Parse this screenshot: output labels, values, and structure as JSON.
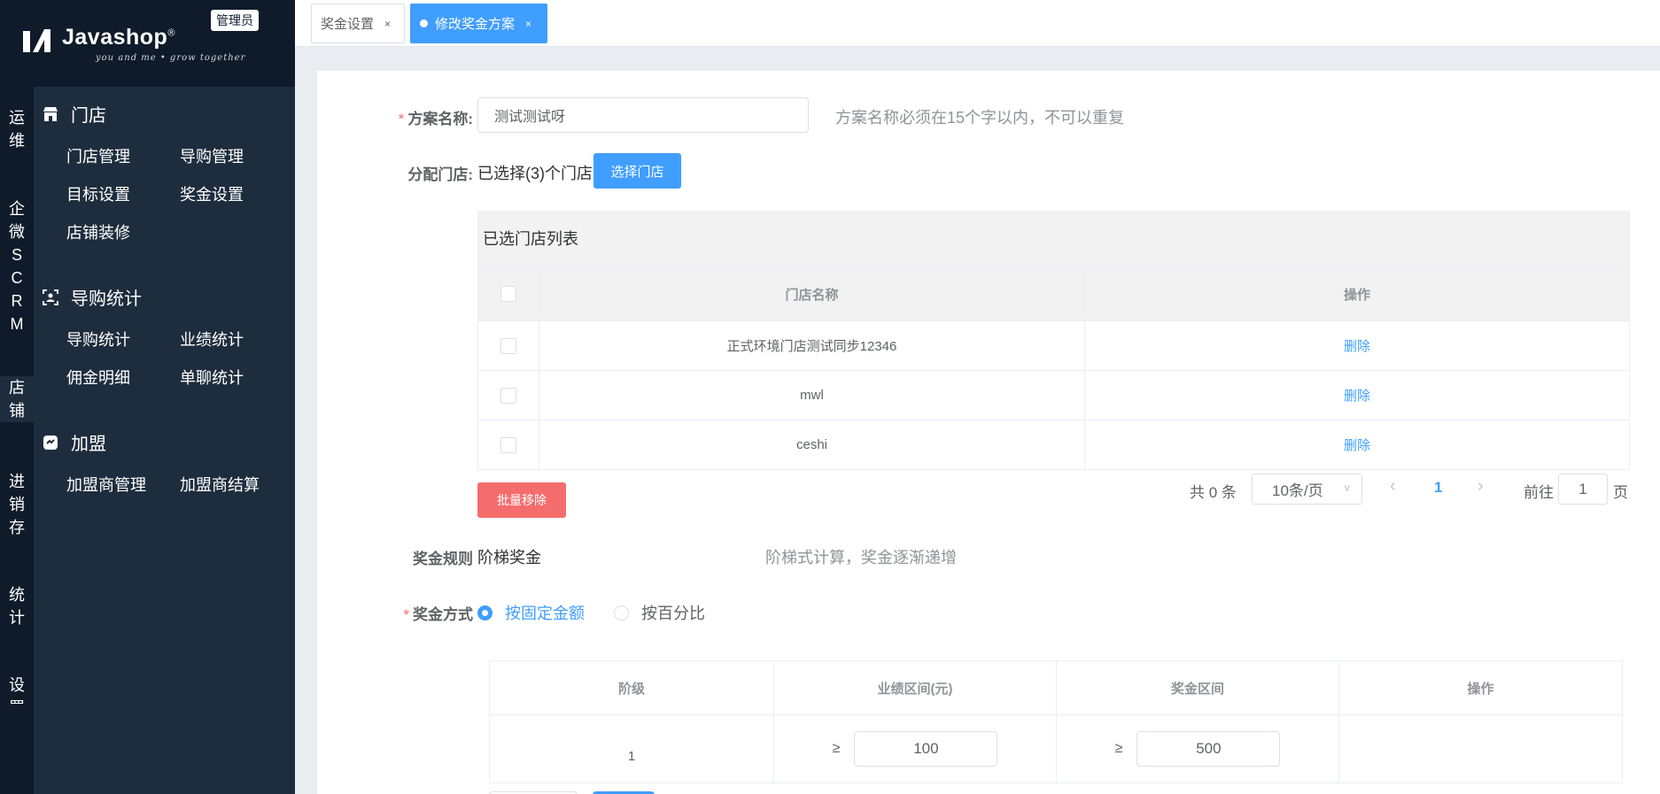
{
  "brand": {
    "logo_text": "Javashop",
    "logo_reg": "®",
    "logo_sub": "you and me • grow together",
    "admin_badge": "管理员"
  },
  "vnav": [
    "运维",
    "企微SCRM",
    "店铺",
    "进销存",
    "统计",
    "设置"
  ],
  "subnav": {
    "groups": [
      {
        "title": "门店",
        "icon": "store-icon",
        "links": [
          "门店管理",
          "导购管理",
          "目标设置",
          "奖金设置",
          "店铺装修"
        ]
      },
      {
        "title": "导购统计",
        "icon": "user-frame-icon",
        "links": [
          "导购统计",
          "业绩统计",
          "佣金明细",
          "单聊统计"
        ]
      },
      {
        "title": "加盟",
        "icon": "franchise-icon",
        "links": [
          "加盟商管理",
          "加盟商结算"
        ]
      }
    ]
  },
  "tabs": [
    {
      "label": "奖金设置",
      "close": "×"
    },
    {
      "label": "修改奖金方案",
      "close": "×"
    }
  ],
  "form": {
    "plan_name_label": "方案名称:",
    "plan_name_value": "测试测试呀",
    "plan_name_hint": "方案名称必须在15个字以内，不可以重复",
    "assign_label": "分配门店:",
    "assign_text": "已选择(3)个门店",
    "select_store_btn": "选择门店",
    "rule_label": "奖金规则",
    "rule_value": "阶梯奖金",
    "rule_hint": "阶梯式计算，奖金逐渐递增",
    "method_label": "奖金方式",
    "method_options": [
      "按固定金额",
      "按百分比"
    ],
    "required_mark": "*"
  },
  "store_table": {
    "caption": "已选门店列表",
    "headers": [
      "门店名称",
      "操作"
    ],
    "rows": [
      {
        "name": "正式环境门店测试同步12346",
        "action": "删除"
      },
      {
        "name": "mwl",
        "action": "删除"
      },
      {
        "name": "ceshi",
        "action": "删除"
      }
    ]
  },
  "batch_remove_btn": "批量移除",
  "pagination": {
    "total": "共 0 条",
    "page_size": "10条/页",
    "current": "1",
    "goto_label": "前往",
    "goto_value": "1",
    "page_suffix": "页"
  },
  "tier_table": {
    "headers": [
      "阶级",
      "业绩区间(元)",
      "奖金区间",
      "操作"
    ],
    "rows": [
      {
        "level": "1",
        "ge1": "≥",
        "perf": "100",
        "ge2": "≥",
        "bonus": "500"
      }
    ]
  },
  "colors": {
    "primary": "#409eff",
    "danger": "#f56c6c",
    "sidebar_dark": "#0f1b2a",
    "sidebar": "#1e2d3e"
  }
}
